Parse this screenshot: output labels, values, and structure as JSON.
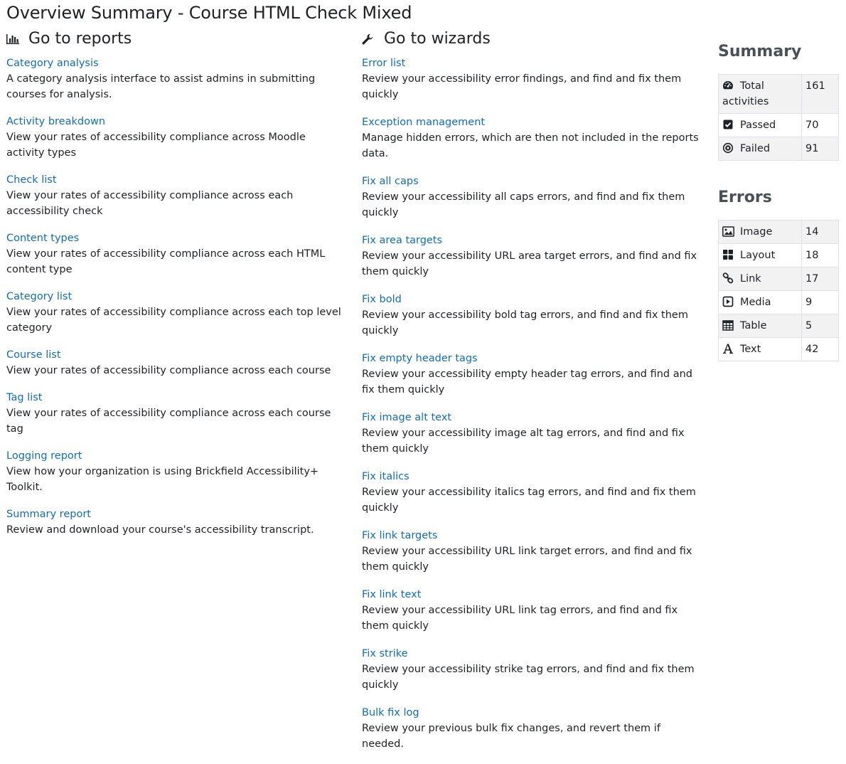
{
  "page_title": "Overview Summary - Course HTML Check Mixed",
  "reports": {
    "heading": "Go to reports",
    "items": [
      {
        "label": "Category analysis",
        "desc": "A category analysis interface to assist admins in submitting courses for analysis."
      },
      {
        "label": "Activity breakdown",
        "desc": "View your rates of accessibility compliance across Moodle activity types"
      },
      {
        "label": "Check list",
        "desc": "View your rates of accessibility compliance across each accessibility check"
      },
      {
        "label": "Content types",
        "desc": "View your rates of accessibility compliance across each HTML content type"
      },
      {
        "label": "Category list",
        "desc": "View your rates of accessibility compliance across each top level category"
      },
      {
        "label": "Course list",
        "desc": "View your rates of accessibility compliance across each course"
      },
      {
        "label": "Tag list",
        "desc": "View your rates of accessibility compliance across each course tag"
      },
      {
        "label": "Logging report",
        "desc": "View how your organization is using Brickfield Accessibility+ Toolkit."
      },
      {
        "label": "Summary report",
        "desc": "Review and download your course's accessibility transcript."
      }
    ]
  },
  "wizards": {
    "heading": "Go to wizards",
    "items": [
      {
        "label": "Error list",
        "desc": "Review your accessibility error findings, and find and fix them quickly"
      },
      {
        "label": "Exception management",
        "desc": "Manage hidden errors, which are then not included in the reports data."
      },
      {
        "label": "Fix all caps",
        "desc": "Review your accessibility all caps errors, and find and fix them quickly"
      },
      {
        "label": "Fix area targets",
        "desc": "Review your accessibility URL area target errors, and find and fix them quickly"
      },
      {
        "label": "Fix bold",
        "desc": "Review your accessibility bold tag errors, and find and fix them quickly"
      },
      {
        "label": "Fix empty header tags",
        "desc": "Review your accessibility empty header tag errors, and find and fix them quickly"
      },
      {
        "label": "Fix image alt text",
        "desc": "Review your accessibility image alt tag errors, and find and fix them quickly"
      },
      {
        "label": "Fix italics",
        "desc": "Review your accessibility italics tag errors, and find and fix them quickly"
      },
      {
        "label": "Fix link targets",
        "desc": "Review your accessibility URL link target errors, and find and fix them quickly"
      },
      {
        "label": "Fix link text",
        "desc": "Review your accessibility URL link tag errors, and find and fix them quickly"
      },
      {
        "label": "Fix strike",
        "desc": "Review your accessibility strike tag errors, and find and fix them quickly"
      },
      {
        "label": "Bulk fix log",
        "desc": "Review your previous bulk fix changes, and revert them if needed."
      }
    ]
  },
  "summary": {
    "heading": "Summary",
    "rows": [
      {
        "icon": "gauge-icon",
        "label": "Total activities",
        "value": "161"
      },
      {
        "icon": "check-square-icon",
        "label": "Passed",
        "value": "70"
      },
      {
        "icon": "times-circle-icon",
        "label": "Failed",
        "value": "91"
      }
    ]
  },
  "errors": {
    "heading": "Errors",
    "rows": [
      {
        "icon": "image-icon",
        "label": "Image",
        "value": "14"
      },
      {
        "icon": "layout-icon",
        "label": "Layout",
        "value": "18"
      },
      {
        "icon": "link-icon",
        "label": "Link",
        "value": "17"
      },
      {
        "icon": "media-icon",
        "label": "Media",
        "value": "9"
      },
      {
        "icon": "table-icon",
        "label": "Table",
        "value": "5"
      },
      {
        "icon": "text-icon",
        "label": "Text",
        "value": "42"
      }
    ]
  },
  "colors": {
    "link": "#0f6cbf",
    "text": "#1d2125",
    "heading_muted": "#495057",
    "row_stripe": "#f2f2f2"
  }
}
